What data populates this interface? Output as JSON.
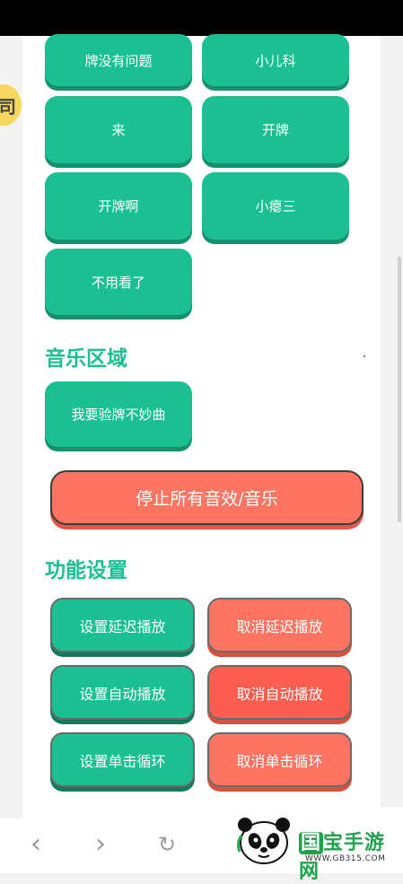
{
  "sound_buttons": [
    {
      "label": "牌没有问题"
    },
    {
      "label": "小儿科"
    },
    {
      "label": "来"
    },
    {
      "label": "开牌"
    },
    {
      "label": "开牌啊"
    },
    {
      "label": "小瘪三"
    },
    {
      "label": "不用看了"
    }
  ],
  "music_section": {
    "title": "音乐区域",
    "buttons": [
      {
        "label": "我要验牌不妙曲"
      }
    ]
  },
  "stop_all_label": "停止所有音效/音乐",
  "settings_section": {
    "title": "功能设置",
    "set_delay": "设置延迟播放",
    "cancel_delay": "取消延迟播放",
    "set_auto": "设置自动播放",
    "cancel_auto": "取消自动播放",
    "set_loop": "设置单击循环",
    "cancel_loop": "取消单击循环"
  },
  "edge_badge_char": "司",
  "nav": {
    "back_icon": "‹",
    "forward_icon": "›",
    "refresh_icon": "↻"
  },
  "watermark": {
    "brand_chip": "国",
    "brand_rest": "宝手游网",
    "url": "WWW.GB315.COM"
  },
  "colors": {
    "accent_green": "#1abf92",
    "accent_red": "#fd7462"
  }
}
